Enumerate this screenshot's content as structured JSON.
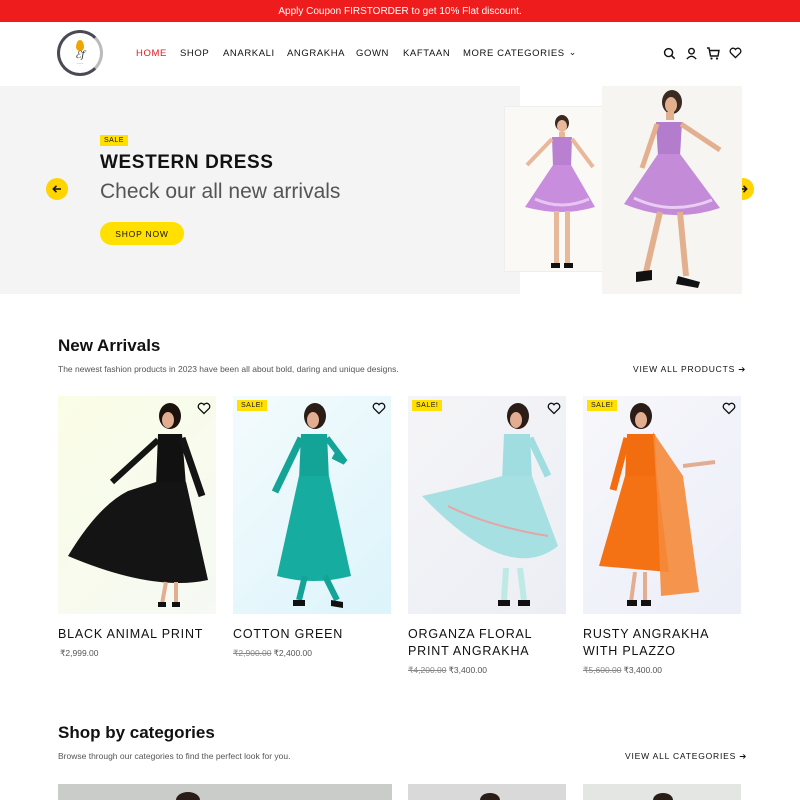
{
  "promo": {
    "text": "Apply Coupon FIRSTORDER to get 10% Flat discount."
  },
  "nav": {
    "items": [
      "HOME",
      "SHOP",
      "ANARKALI",
      "ANGRAKHA",
      "GOWN",
      "KAFTAAN",
      "MORE CATEGORIES"
    ],
    "active": "HOME"
  },
  "header_icons": [
    "search-icon",
    "user-icon",
    "cart-icon",
    "heart-icon"
  ],
  "hero": {
    "badge": "SALE",
    "title": "WESTERN DRESS",
    "subtitle": "Check our all new arrivals",
    "cta": "SHOP NOW"
  },
  "new_arrivals": {
    "title": "New Arrivals",
    "description": "The newest fashion products in 2023 have been all about bold, daring and unique designs.",
    "view_all": "VIEW ALL PRODUCTS"
  },
  "products": [
    {
      "name": "BLACK ANIMAL PRINT",
      "sale": "",
      "old_price": "",
      "price": "₹2,999.00",
      "color": "#111111"
    },
    {
      "name": "COTTON GREEN",
      "sale": "SALE!",
      "old_price": "₹2,900.00",
      "price": "₹2,400.00",
      "color": "#12a69a"
    },
    {
      "name": "ORGANZA FLORAL PRINT ANGRAKHA",
      "sale": "SALE!",
      "old_price": "₹4,200.00",
      "price": "₹3,400.00",
      "color": "#8fd3d6"
    },
    {
      "name": "RUSTY ANGRAKHA WITH PLAZZO",
      "sale": "SALE!",
      "old_price": "₹5,600.00",
      "price": "₹3,400.00",
      "color": "#f06b12"
    }
  ],
  "categories_section": {
    "title": "Shop by categories",
    "description": "Browse through our categories to find the perfect look for you.",
    "view_all": "VIEW ALL CATEGORIES"
  },
  "colors": {
    "promo": "#ee1c1c",
    "accent": "#ffe000",
    "active_nav": "#e11d1d"
  }
}
